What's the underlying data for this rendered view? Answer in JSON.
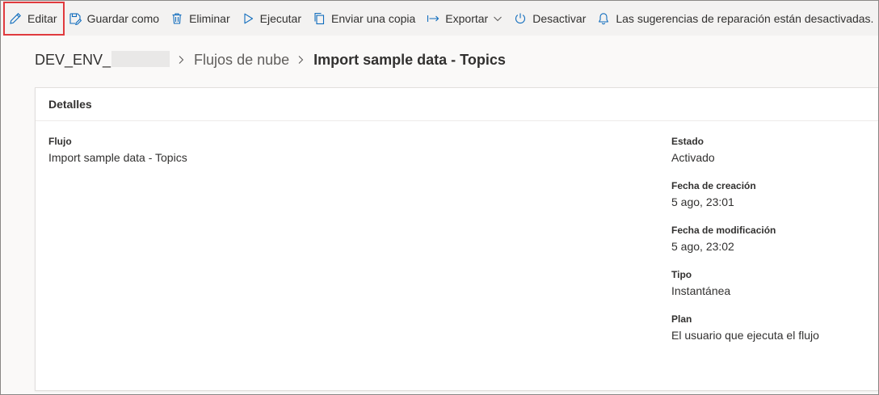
{
  "toolbar": {
    "items": [
      {
        "label": "Editar",
        "icon": "pencil-icon"
      },
      {
        "label": "Guardar como",
        "icon": "save-as-icon"
      },
      {
        "label": "Eliminar",
        "icon": "trash-icon"
      },
      {
        "label": "Ejecutar",
        "icon": "play-icon"
      },
      {
        "label": "Enviar una copia",
        "icon": "copy-icon"
      },
      {
        "label": "Exportar",
        "icon": "export-icon"
      },
      {
        "label": "Desactivar",
        "icon": "power-icon"
      },
      {
        "label": "Las sugerencias de reparación están desactivadas.",
        "icon": "bell-icon"
      }
    ]
  },
  "breadcrumb": {
    "environment": "DEV_ENV_",
    "section": "Flujos de nube",
    "current": "Import sample data - Topics"
  },
  "details": {
    "header": "Detalles",
    "flow_label": "Flujo",
    "flow_value": "Import sample data - Topics",
    "fields": [
      {
        "label": "Estado",
        "value": "Activado"
      },
      {
        "label": "Fecha de creación",
        "value": "5 ago, 23:01"
      },
      {
        "label": "Fecha de modificación",
        "value": "5 ago, 23:02"
      },
      {
        "label": "Tipo",
        "value": "Instantánea"
      },
      {
        "label": "Plan",
        "value": "El usuario que ejecuta el flujo"
      }
    ]
  },
  "colors": {
    "accent": "#0f6cbd",
    "highlight": "#e03a3e",
    "toolbar_bg": "#f3f2f1"
  }
}
